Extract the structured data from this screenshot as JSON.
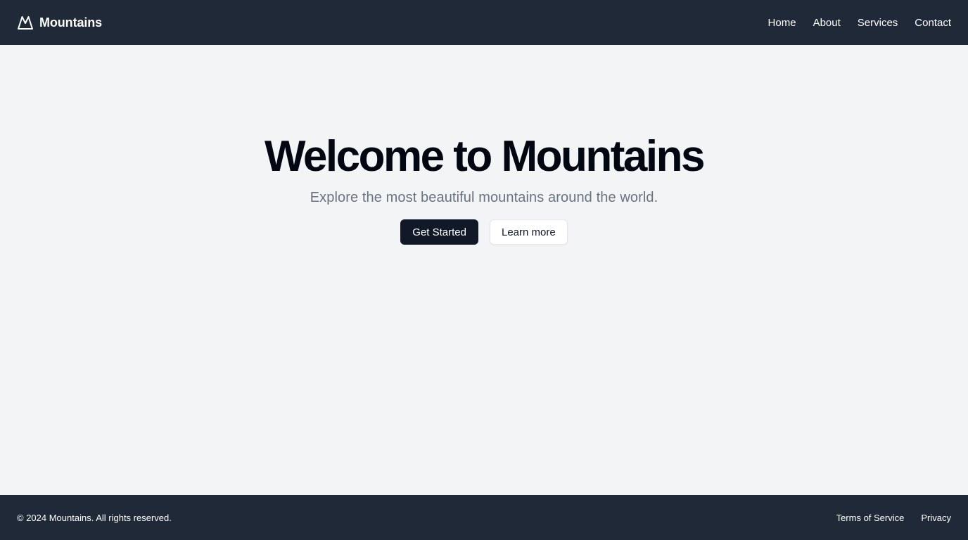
{
  "header": {
    "brand": {
      "name": "Mountains",
      "icon": "mountain-icon"
    },
    "nav": [
      {
        "label": "Home"
      },
      {
        "label": "About"
      },
      {
        "label": "Services"
      },
      {
        "label": "Contact"
      }
    ]
  },
  "hero": {
    "title": "Welcome to Mountains",
    "subtitle": "Explore the most beautiful mountains around the world.",
    "primary_button": "Get Started",
    "secondary_button": "Learn more"
  },
  "footer": {
    "copyright": "© 2024 Mountains. All rights reserved.",
    "links": [
      {
        "label": "Terms of Service"
      },
      {
        "label": "Privacy"
      }
    ]
  },
  "colors": {
    "header_bg": "#1f2937",
    "page_bg": "#f3f4f6",
    "primary_button_bg": "#111827",
    "subtitle_text": "#6b7280"
  }
}
